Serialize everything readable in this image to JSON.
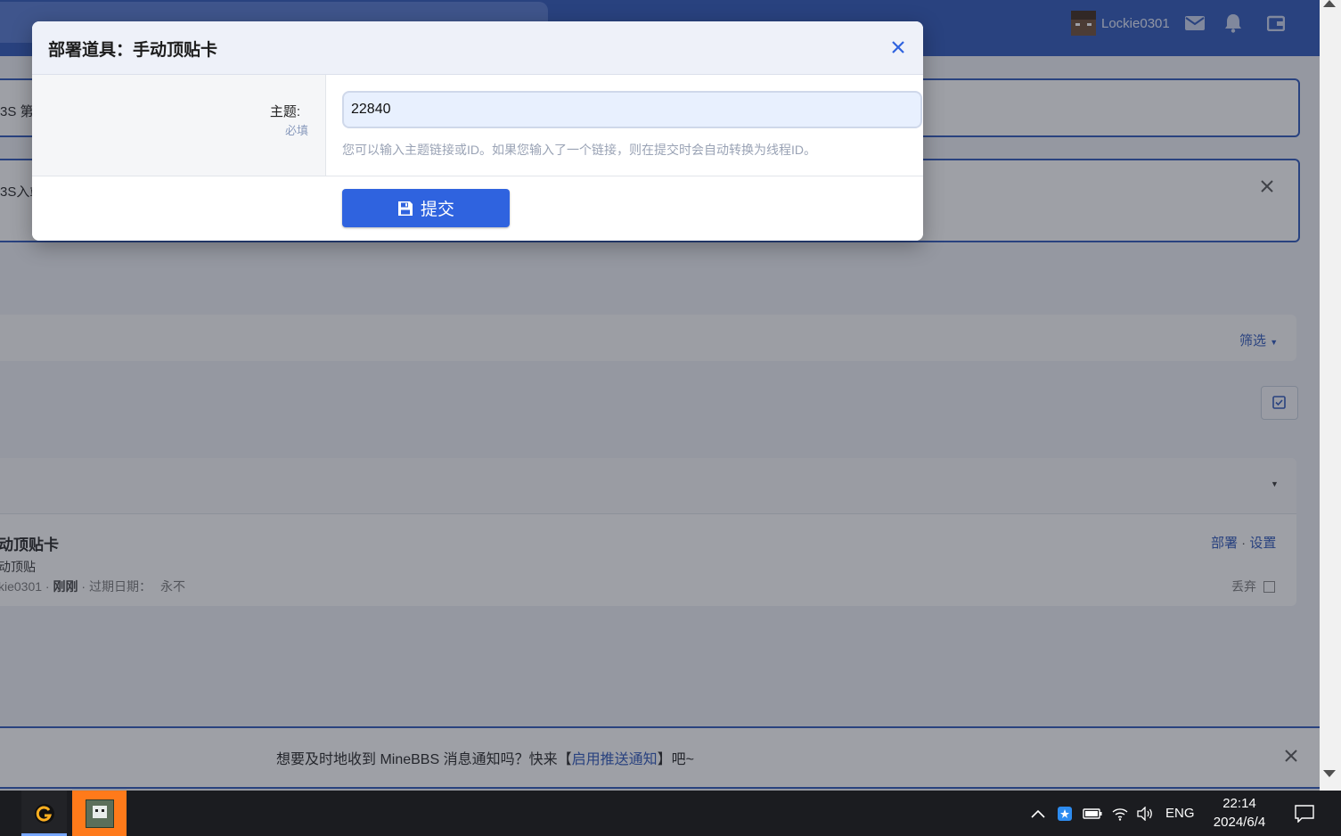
{
  "header": {
    "username": "Lockie0301"
  },
  "background": {
    "notice1_fragment": "3S 第",
    "notice2_fragment": "3S入站",
    "filter_label": "筛选",
    "item": {
      "title": "动顶贴卡",
      "subtitle": "动顶贴",
      "meta_user": "kie0301",
      "meta_sep1": " · ",
      "meta_time": "刚刚",
      "meta_expiry_label": " · 过期日期：",
      "meta_expiry_value": "永不",
      "action_deploy": "部署",
      "action_sep": " · ",
      "action_settings": "设置",
      "discard_label": "丢弃"
    },
    "push_notice": {
      "before": "想要及时地收到 MineBBS 消息通知吗？快来【",
      "link": "启用推送通知",
      "after": "】吧~"
    }
  },
  "modal": {
    "title": "部署道具：手动顶贴卡",
    "field_label": "主题:",
    "field_required": "必填",
    "field_value": "22840",
    "field_explain": "您可以输入主题链接或ID。如果您输入了一个链接，则在提交时会自动转换为线程ID。",
    "submit_label": "提交"
  },
  "taskbar": {
    "lang": "ENG",
    "time": "22:14",
    "date": "2024/6/4"
  },
  "colors": {
    "brand": "#2a54b9",
    "submit": "#2f63df"
  }
}
